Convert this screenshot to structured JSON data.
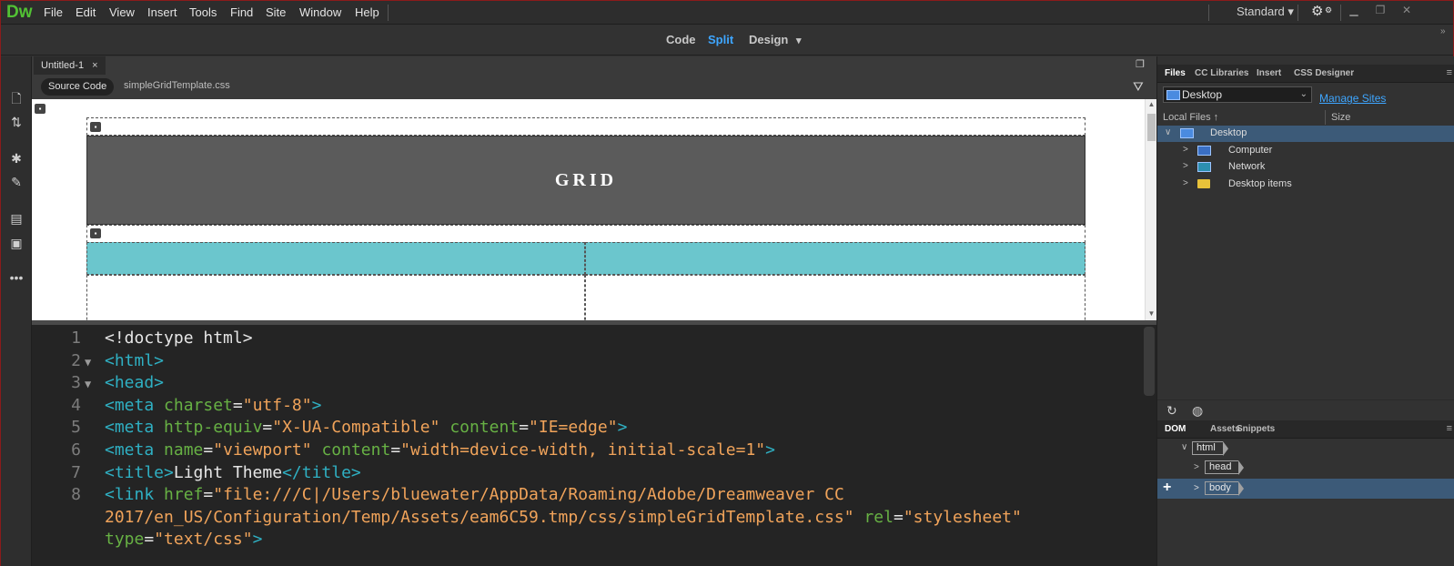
{
  "app": {
    "logo": "Dw"
  },
  "menu": [
    "File",
    "Edit",
    "View",
    "Insert",
    "Tools",
    "Find",
    "Site",
    "Window",
    "Help"
  ],
  "workspace": {
    "label": "Standard",
    "caret": "▾"
  },
  "view_modes": {
    "code": "Code",
    "split": "Split",
    "design": "Design",
    "active": "Split",
    "caret": "▾"
  },
  "document": {
    "tab_title": "Untitled-1",
    "tab_close": "×",
    "source_code_button": "Source Code",
    "related_file": "simpleGridTemplate.css"
  },
  "design_view": {
    "grid_title": "GRID"
  },
  "code_lines": [
    {
      "n": "1",
      "fold": "",
      "parts": [
        [
          "txt",
          "<!doctype html>"
        ]
      ]
    },
    {
      "n": "2",
      "fold": "▼",
      "parts": [
        [
          "tag",
          "<html>"
        ]
      ]
    },
    {
      "n": "3",
      "fold": "▼",
      "parts": [
        [
          "tag",
          "<head>"
        ]
      ]
    },
    {
      "n": "4",
      "fold": "",
      "parts": [
        [
          "tag",
          "<meta "
        ],
        [
          "attr",
          "charset"
        ],
        [
          "txt",
          "="
        ],
        [
          "str",
          "\"utf-8\""
        ],
        [
          "tag",
          ">"
        ]
      ]
    },
    {
      "n": "5",
      "fold": "",
      "parts": [
        [
          "tag",
          "<meta "
        ],
        [
          "attr",
          "http-equiv"
        ],
        [
          "txt",
          "="
        ],
        [
          "str",
          "\"X-UA-Compatible\""
        ],
        [
          "txt",
          " "
        ],
        [
          "attr",
          "content"
        ],
        [
          "txt",
          "="
        ],
        [
          "str",
          "\"IE=edge\""
        ],
        [
          "tag",
          ">"
        ]
      ]
    },
    {
      "n": "6",
      "fold": "",
      "parts": [
        [
          "tag",
          "<meta "
        ],
        [
          "attr",
          "name"
        ],
        [
          "txt",
          "="
        ],
        [
          "str",
          "\"viewport\""
        ],
        [
          "txt",
          " "
        ],
        [
          "attr",
          "content"
        ],
        [
          "txt",
          "="
        ],
        [
          "str",
          "\"width=device-width, initial-scale=1\""
        ],
        [
          "tag",
          ">"
        ]
      ]
    },
    {
      "n": "7",
      "fold": "",
      "parts": [
        [
          "tag",
          "<title>"
        ],
        [
          "txt",
          "Light Theme"
        ],
        [
          "tag",
          "</title>"
        ]
      ]
    },
    {
      "n": "8",
      "fold": "",
      "parts": [
        [
          "tag",
          "<link "
        ],
        [
          "attr",
          "href"
        ],
        [
          "txt",
          "="
        ],
        [
          "str",
          "\"file:///C|/Users/bluewater/AppData/Roaming/Adobe/Dreamweaver CC"
        ]
      ]
    },
    {
      "n": "",
      "fold": "",
      "parts": [
        [
          "str",
          "2017/en_US/Configuration/Temp/Assets/eam6C59.tmp/css/simpleGridTemplate.css\""
        ],
        [
          "txt",
          " "
        ],
        [
          "attr",
          "rel"
        ],
        [
          "txt",
          "="
        ],
        [
          "str",
          "\"stylesheet\""
        ]
      ]
    },
    {
      "n": "",
      "fold": "",
      "parts": [
        [
          "attr",
          "type"
        ],
        [
          "txt",
          "="
        ],
        [
          "str",
          "\"text/css\""
        ],
        [
          "tag",
          ">"
        ]
      ]
    }
  ],
  "files_panel": {
    "tabs": [
      "Files",
      "CC Libraries",
      "Insert",
      "CSS Designer"
    ],
    "active_tab": "Files",
    "site_select": "Desktop",
    "manage_sites": "Manage Sites",
    "col_local_files": "Local Files",
    "col_size": "Size",
    "tree": [
      {
        "label": "Desktop",
        "chev": "∨",
        "selected": true
      },
      {
        "label": "Computer",
        "chev": ">",
        "selected": false
      },
      {
        "label": "Network",
        "chev": ">",
        "selected": false
      },
      {
        "label": "Desktop items",
        "chev": ">",
        "selected": false
      }
    ]
  },
  "dom_panel": {
    "tabs": [
      "DOM",
      "Assets",
      "Snippets"
    ],
    "active_tab": "DOM",
    "nodes": [
      "html",
      "head",
      "body"
    ],
    "add_symbol": "+"
  },
  "colors": {
    "accent": "#3ea6ff",
    "logo": "#52c234",
    "teal": "#6bc6cd",
    "grid_header": "#5b5b5b"
  }
}
